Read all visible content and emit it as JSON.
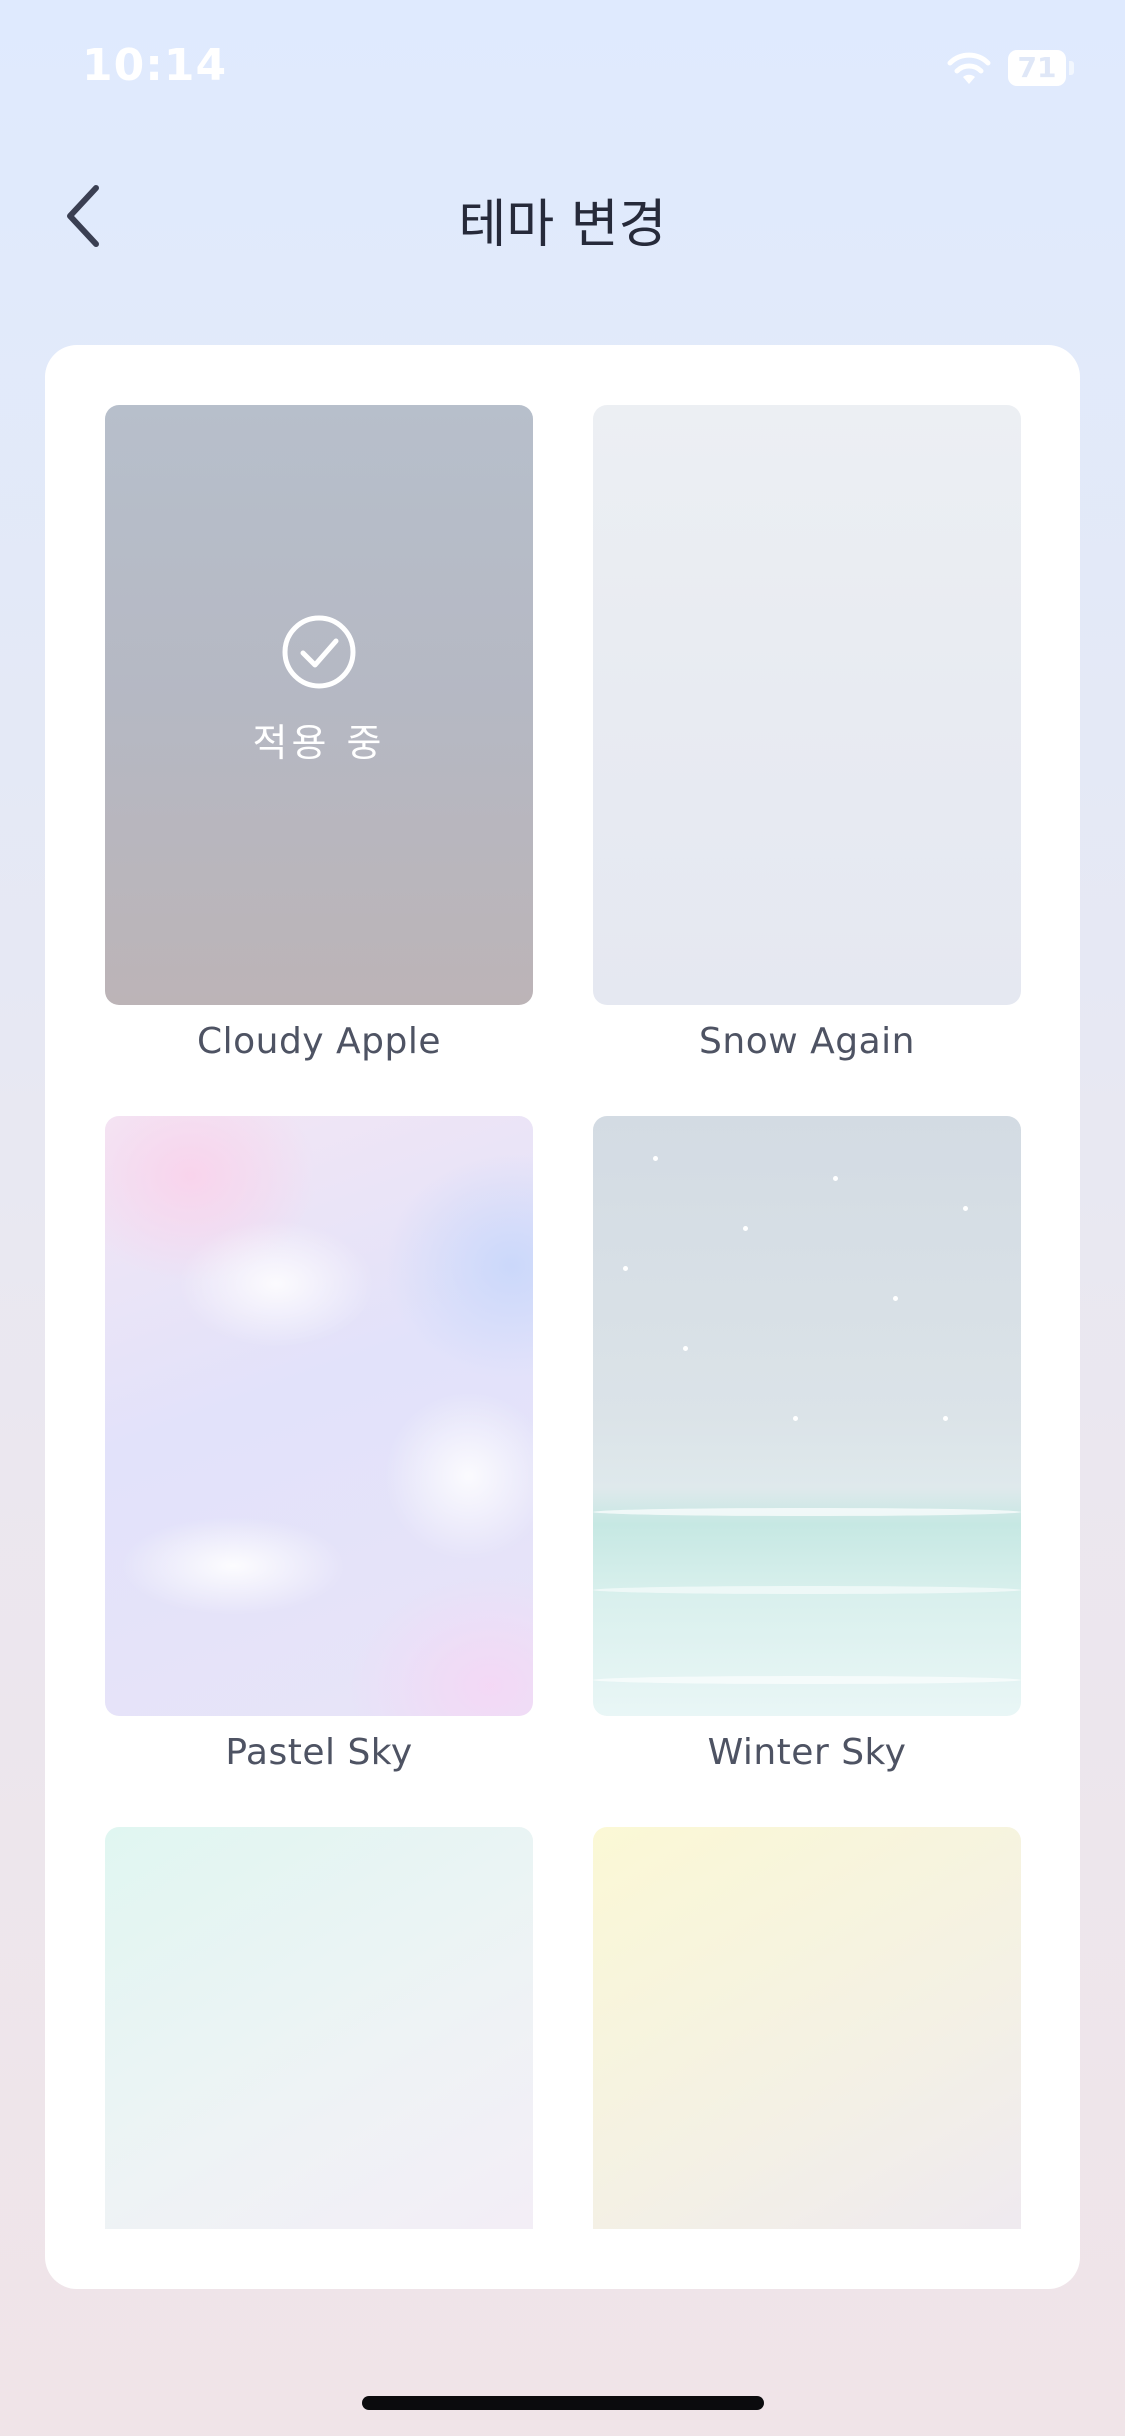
{
  "status_bar": {
    "time": "10:14",
    "battery": "71",
    "wifi_icon": "wifi-icon"
  },
  "header": {
    "title": "테마 변경",
    "back_icon": "chevron-left-icon"
  },
  "themes": [
    {
      "name": "Cloudy Apple",
      "applied": true,
      "applied_label": "적용 중"
    },
    {
      "name": "Snow Again",
      "applied": false
    },
    {
      "name": "Pastel Sky",
      "applied": false
    },
    {
      "name": "Winter Sky",
      "applied": false
    },
    {
      "name": "",
      "applied": false
    },
    {
      "name": "",
      "applied": false
    }
  ],
  "colors": {
    "text_primary": "#262a3a",
    "theme_label": "#4e5363",
    "card_background": "#ffffff"
  }
}
